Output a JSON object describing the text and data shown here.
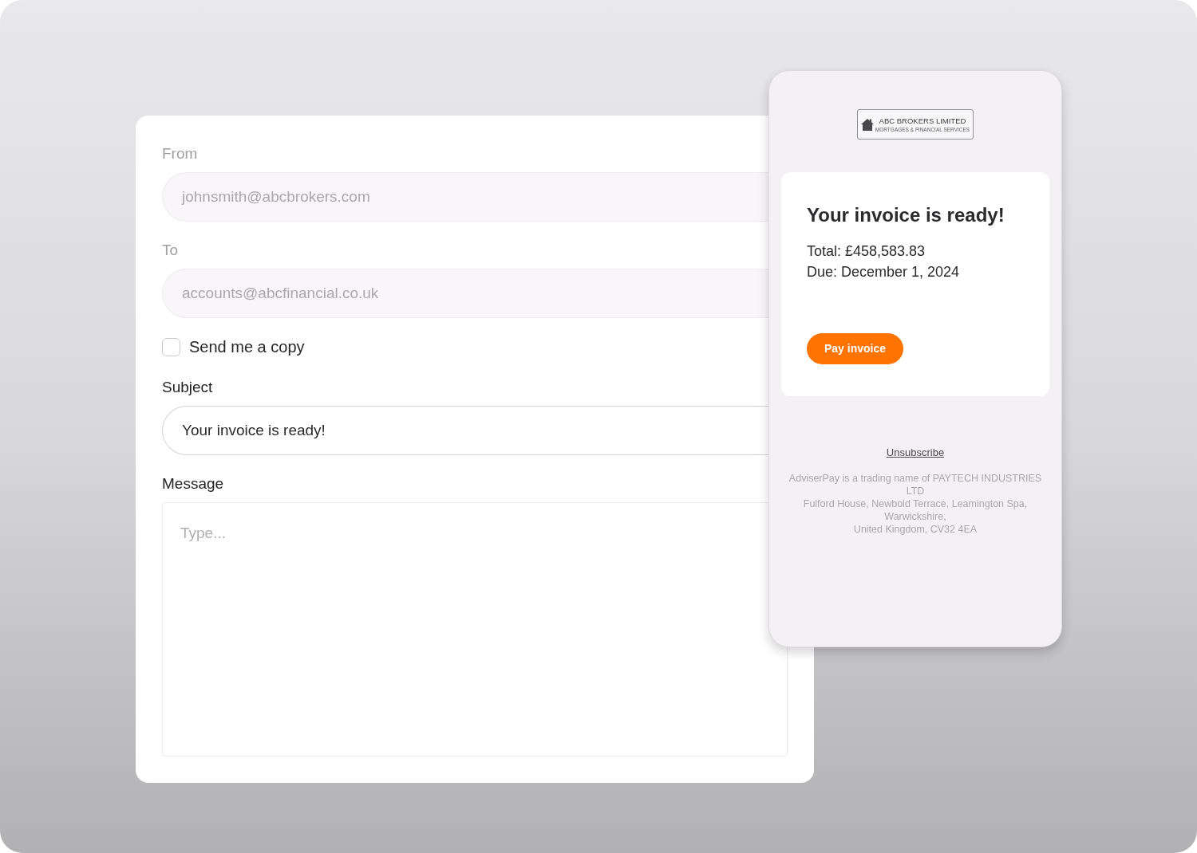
{
  "email_form": {
    "fields": [
      {
        "label": "From",
        "value": "johnsmith@abcbrokers.com",
        "disabled": true
      },
      {
        "label": "To",
        "value": "accounts@abcfinancial.co.uk",
        "disabled": true
      }
    ],
    "send_copy": {
      "label": "Send me a copy",
      "checked": false
    },
    "subject": {
      "label": "Subject",
      "value": "Your invoice is ready!",
      "disabled": false
    },
    "message": {
      "label": "Message",
      "placeholder": "Type..."
    }
  },
  "email_preview": {
    "logo": {
      "name": "ABC BROKERS LIMITED",
      "tagline": "MORTGAGES & FINANCIAL SERVICES"
    },
    "invoice": {
      "title": "Your invoice is ready!",
      "total": "Total: £458,583.83",
      "due": "Due: December 1, 2024",
      "button": "Pay invoice"
    },
    "unsubscribe": "Unsubscribe",
    "footer_lines": [
      "AdviserPay is a trading name of PAYTECH INDUSTRIES LTD",
      "Fulford House, Newbold Terrace, Leamington Spa, Warwickshire,",
      "United Kingdom, CV32 4EA"
    ]
  }
}
